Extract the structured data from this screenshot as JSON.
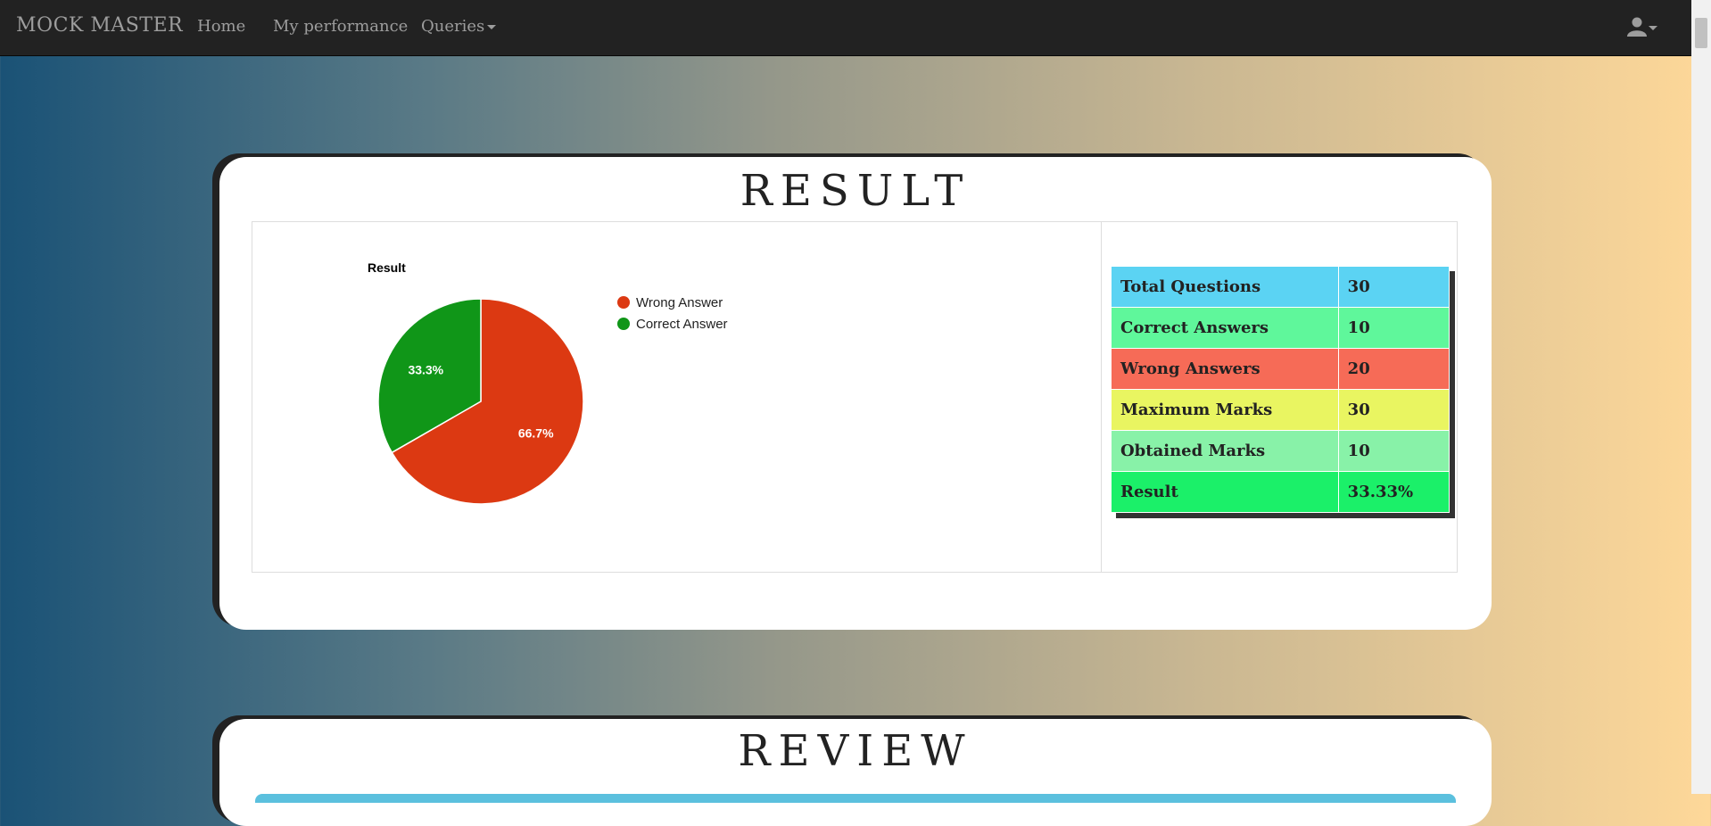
{
  "nav": {
    "brand": "MOCK MASTER",
    "home": "Home",
    "performance": "My performance",
    "queries": "Queries"
  },
  "result_card": {
    "title": "RESULT"
  },
  "review_card": {
    "title": "REVIEW"
  },
  "stats": [
    {
      "label": "Total Questions",
      "value": "30",
      "color": "#5bd3f3"
    },
    {
      "label": "Correct Answers",
      "value": "10",
      "color": "#5ff79b"
    },
    {
      "label": "Wrong Answers",
      "value": "20",
      "color": "#f66b57"
    },
    {
      "label": "Maximum Marks",
      "value": "30",
      "color": "#e9f561"
    },
    {
      "label": "Obtained Marks",
      "value": "10",
      "color": "#88f2a8"
    },
    {
      "label": "Result",
      "value": "33.33%",
      "color": "#1bf069"
    }
  ],
  "chart_data": {
    "type": "pie",
    "title": "Result",
    "legend_position": "right",
    "slices": [
      {
        "name": "Wrong Answer",
        "value": 66.7,
        "label": "66.7%",
        "color": "#dc3912"
      },
      {
        "name": "Correct Answer",
        "value": 33.3,
        "label": "33.3%",
        "color": "#109618"
      }
    ]
  }
}
